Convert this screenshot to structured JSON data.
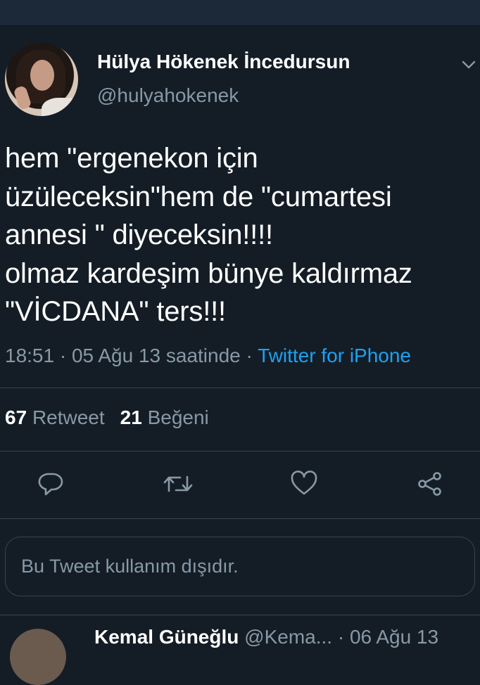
{
  "tweet": {
    "author_name": "Hülya Hökenek İncedursun",
    "author_handle": "@hulyahokenek",
    "text": "hem \"ergenekon için\nüzüleceksin\"hem de \"cumartesi\nannesi \" diyeceksin!!!!\nolmaz kardeşim bünye kaldırmaz\n\"VİCDANA\" ters!!!",
    "time": "18:51",
    "date": "05 Ağu 13 saatinde",
    "separator": "·",
    "source": "Twitter for iPhone",
    "retweet_count": "67",
    "retweet_label": "Retweet",
    "like_count": "21",
    "like_label": "Beğeni"
  },
  "actions": {
    "reply_icon": "reply-icon",
    "retweet_icon": "retweet-icon",
    "like_icon": "heart-icon",
    "share_icon": "share-icon"
  },
  "reply_box": {
    "placeholder": "Bu Tweet kullanım dışıdır."
  },
  "next_tweet": {
    "name": "Kemal Güneğlu",
    "handle": "@Kema...",
    "date": "06 Ağu 13"
  },
  "colors": {
    "background": "#141d26",
    "secondary_text": "#8899a6",
    "link": "#1da1f2",
    "divider": "#38444d"
  }
}
